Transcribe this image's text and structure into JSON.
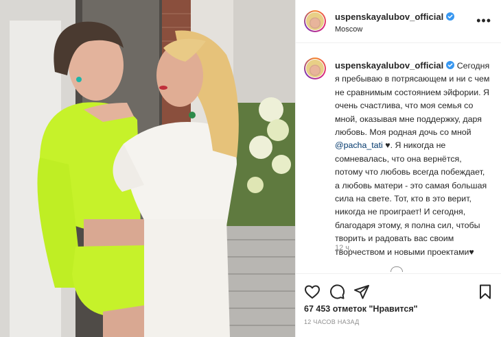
{
  "post": {
    "username": "uspenskayalubov_official",
    "location": "Moscow",
    "more_icon": "more-options-icon",
    "verified_color": "#3897f0"
  },
  "caption": {
    "username": "uspenskayalubov_official",
    "text_before_mention": "Сегодня я пребываю в потрясающем и ни с чем не сравнимым состоянием эйфории. Я очень счастлива, что моя семья со мной, оказывая мне поддержку, даря любовь. Моя родная дочь со мной ",
    "mention": "@pacha_tati",
    "text_after_mention": " ♥. Я никогда не сомневалась, что она вернётся, потому что любовь всегда побеждает, а любовь матери - это самая большая сила на свете. Тот, кто в это верит, никогда не проиграет! И сегодня, благодаря этому, я полна сил, чтобы творить и радовать вас своим творчеством и новыми проектами♥",
    "time": "12 ч."
  },
  "actions": {
    "like_icon": "heart-icon",
    "comment_icon": "comment-icon",
    "share_icon": "share-icon",
    "save_icon": "bookmark-icon",
    "likes_text": "67 453 отметок \"Нравится\"",
    "posted_text": "12 ЧАСОВ НАЗАД"
  },
  "colors": {
    "mention": "#00376b",
    "secondary_text": "#8e8e8e",
    "border": "#efefef"
  }
}
